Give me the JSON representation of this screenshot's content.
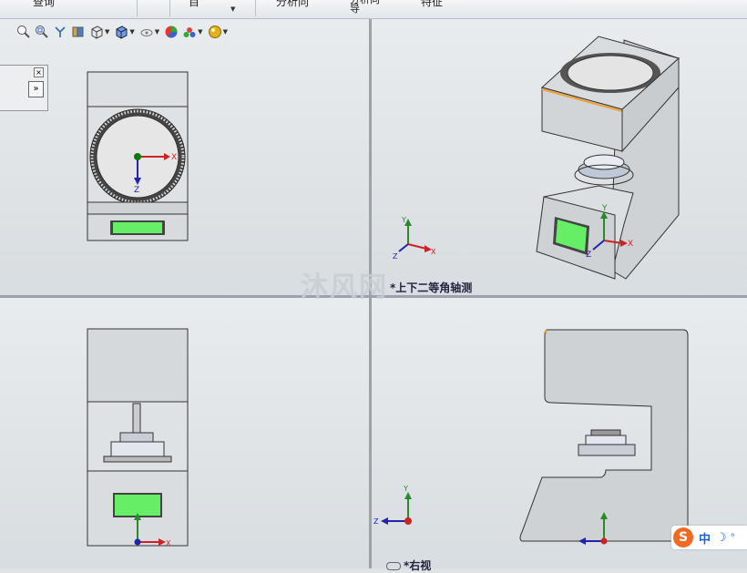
{
  "ribbon": {
    "items": [
      "查询",
      "目",
      "分析向",
      "分析向导",
      "特征"
    ]
  },
  "toolbar": {
    "icons": [
      "zoom-to-fit-icon",
      "zoom-area-icon",
      "previous-view-icon",
      "section-view-icon",
      "view-orientation-icon",
      "display-style-icon",
      "hide-show-items-icon",
      "edit-appearance-icon",
      "apply-scene-icon",
      "view-settings-icon"
    ]
  },
  "views": {
    "top_right_label": "*上下二等角轴测",
    "bottom_right_label": "*右视"
  },
  "axes": {
    "x": "X",
    "y": "Y",
    "z": "Z"
  },
  "watermark": "沐风网",
  "ime": {
    "label": "中"
  },
  "colors": {
    "screen": "#66ee66",
    "machine_body": "#cfd2d4",
    "edge": "#333333",
    "axis_x": "#cc2222",
    "axis_y": "#2a8a2a",
    "axis_z": "#2222aa",
    "highlight": "#f0a030"
  }
}
